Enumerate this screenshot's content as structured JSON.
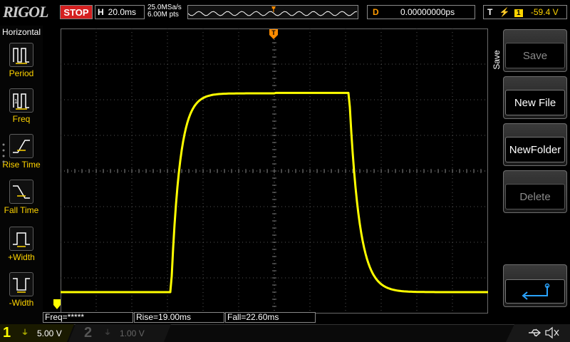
{
  "header": {
    "logo": "RIGOL",
    "run_state": "STOP",
    "horizontal_label": "H",
    "timebase": "20.0ms",
    "sample_rate": "25.0MSa/s",
    "memory_depth": "6.00M pts",
    "trigger_marker": "T",
    "delay_label": "D",
    "delay_value": "0.00000000ps",
    "trigger_label": "T",
    "trigger_channel": "1",
    "trigger_level": "-59.4 V"
  },
  "left_menu": {
    "title": "Horizontal",
    "items": [
      {
        "label": "Period"
      },
      {
        "label": "Freq"
      },
      {
        "label": "Rise Time"
      },
      {
        "label": "Fall Time"
      },
      {
        "label": "+Width"
      },
      {
        "label": "-Width"
      }
    ]
  },
  "right_menu": {
    "tab_label": "Save",
    "buttons": [
      {
        "label": "Save",
        "enabled": false
      },
      {
        "label": "New File",
        "enabled": true
      },
      {
        "label": "NewFolder",
        "enabled": true
      },
      {
        "label": "Delete",
        "enabled": false
      }
    ],
    "back_icon": "return-arrow-icon"
  },
  "measurements": [
    {
      "text": "Freq=*****"
    },
    {
      "text": "Rise=19.00ms"
    },
    {
      "text": "Fall=22.60ms"
    }
  ],
  "channels": [
    {
      "number": "1",
      "scale": "5.00 V",
      "color": "#ffff00",
      "active": true
    },
    {
      "number": "2",
      "scale": "1.00 V",
      "color": "#00e5ff",
      "active": false
    }
  ],
  "status_icons": [
    "usb-icon",
    "mute-icon"
  ],
  "colors": {
    "trace": "#ffff00",
    "stop": "#d42020",
    "delay_label": "#ff9a00",
    "trigger_marker": "#ff8c00",
    "grid": "#6a6a6a"
  }
}
